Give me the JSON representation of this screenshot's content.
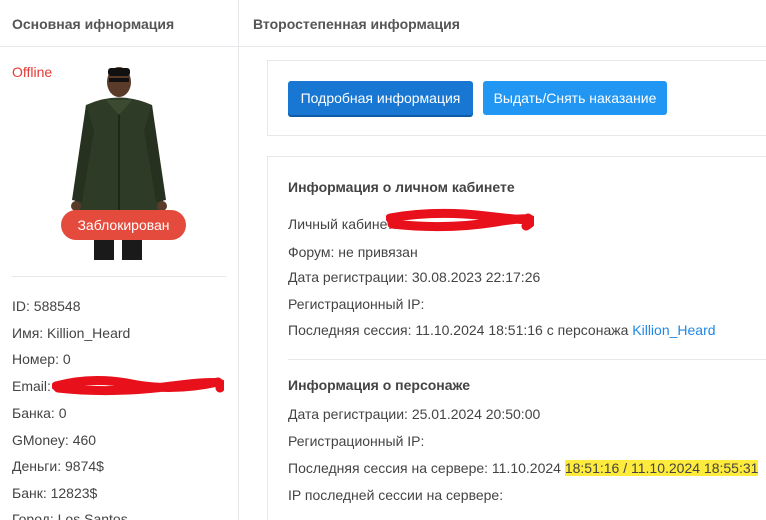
{
  "header": {
    "left_title": "Основная ифнормация",
    "right_title": "Второстепенная информация"
  },
  "profile": {
    "status": "Offline",
    "badge": "Заблокирован",
    "fields": [
      {
        "text": "ID: 588548"
      },
      {
        "text": "Имя: Killion_Heard"
      },
      {
        "text": "Номер: 0"
      },
      {
        "text": "Email:"
      },
      {
        "text": "Банка: 0"
      },
      {
        "text": "GMoney: 460"
      },
      {
        "text": "Деньги: 9874$"
      },
      {
        "text": "Банк: 12823$"
      },
      {
        "text": "Город: Los Santos"
      }
    ]
  },
  "actions": {
    "details_label": "Подробная информация",
    "punish_label": "Выдать/Снять наказание"
  },
  "account": {
    "title": "Информация о личном кабинете",
    "cabinet_label": "Личный кабинет:",
    "forum": "Форум: не привязан",
    "reg_date": "Дата регистрации: 30.08.2023 22:17:26",
    "reg_ip": "Регистрационный IP:",
    "last_session_prefix": "Последняя сессия: 11.10.2024 18:51:16 с персонажа ",
    "last_session_char": "Killion_Heard"
  },
  "character": {
    "title": "Информация о персонаже",
    "reg_date": "Дата регистрации: 25.01.2024 20:50:00",
    "reg_ip": "Регистрационный IP:",
    "server_session_prefix": "Последняя сессия на сервере: 11.10.2024 ",
    "server_session_highlight": "18:51:16 / 11.10.2024 18:55:31",
    "last_ip": "IP последней сессии на сервере:"
  },
  "colors": {
    "offline": "#e53935",
    "badge": "#e54b3c",
    "primary_button": "#1877d3",
    "info_button": "#2196f3",
    "link": "#1e88e5",
    "highlight": "#ffeb3b",
    "redaction": "#e8101a"
  }
}
